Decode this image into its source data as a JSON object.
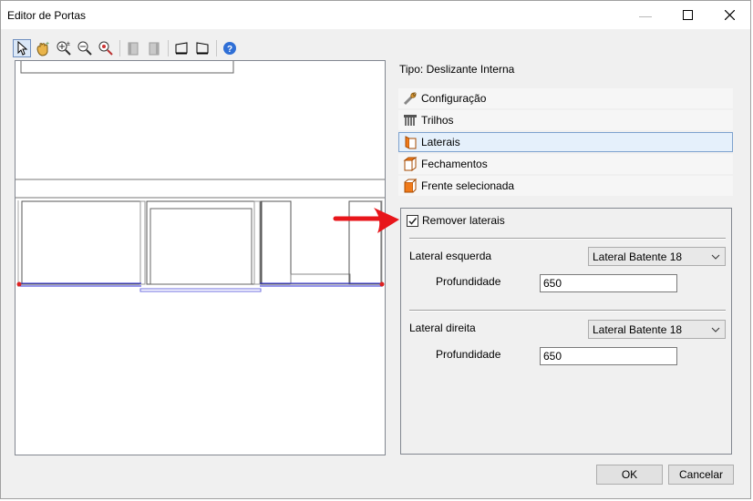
{
  "window": {
    "title": "Editor de Portas"
  },
  "toolbar": {
    "tools": [
      "select-arrow-icon",
      "pan-hand-icon",
      "zoom-in-icon",
      "zoom-out-icon",
      "zoom-fit-icon",
      "panel-left-icon",
      "panel-right-icon",
      "shape-left-icon",
      "shape-right-icon",
      "help-icon"
    ]
  },
  "tipo_label": "Tipo: Deslizante Interna",
  "nav": {
    "items": [
      {
        "label": "Configuração",
        "icon": "wrench-icon"
      },
      {
        "label": "Trilhos",
        "icon": "rails-icon"
      },
      {
        "label": "Laterais",
        "icon": "side-panel-icon"
      },
      {
        "label": "Fechamentos",
        "icon": "closing-panel-icon"
      },
      {
        "label": "Frente selecionada",
        "icon": "front-panel-icon"
      }
    ]
  },
  "panel": {
    "remover_label": "Remover laterais",
    "remover_checked": true,
    "esquerda": {
      "label": "Lateral esquerda",
      "selected": "Lateral Batente 18",
      "prof_label": "Profundidade",
      "prof_value": "650"
    },
    "direita": {
      "label": "Lateral direita",
      "selected": "Lateral Batente 18",
      "prof_label": "Profundidade",
      "prof_value": "650"
    }
  },
  "buttons": {
    "ok": "OK",
    "cancel": "Cancelar"
  },
  "colors": {
    "arrow": "#e8161b",
    "selection_border": "#7da2ce",
    "rail_blue": "#2b2bd6"
  }
}
